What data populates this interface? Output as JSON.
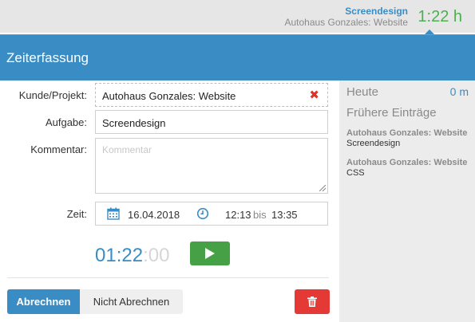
{
  "topbar": {
    "task": "Screendesign",
    "project": "Autohaus Gonzales: Website",
    "elapsed": "1:22 h"
  },
  "header": {
    "title": "Zeiterfassung"
  },
  "form": {
    "customer_label": "Kunde/Projekt:",
    "customer_value": "Autohaus Gonzales: Website",
    "task_label": "Aufgabe:",
    "task_value": "Screendesign",
    "comment_label": "Kommentar:",
    "comment_placeholder": "Kommentar",
    "time_label": "Zeit:",
    "date": "16.04.2018",
    "start": "12:13",
    "until": "bis",
    "end": "13:35"
  },
  "stopwatch": {
    "hours": "01",
    "minutes": "22",
    "seconds": "00"
  },
  "actions": {
    "bill": "Abrechnen",
    "no_bill": "Nicht Abrechnen"
  },
  "sidebar": {
    "today_label": "Heute",
    "today_value": "0 m",
    "earlier_title": "Frühere Einträge",
    "entries": [
      {
        "project": "Autohaus Gonzales: Website",
        "task": "Screendesign"
      },
      {
        "project": "Autohaus Gonzales: Website",
        "task": "CSS"
      }
    ]
  },
  "colors": {
    "accent": "#3a8cc4",
    "running": "#4caf50",
    "play": "#46a046",
    "danger": "#e53935"
  }
}
